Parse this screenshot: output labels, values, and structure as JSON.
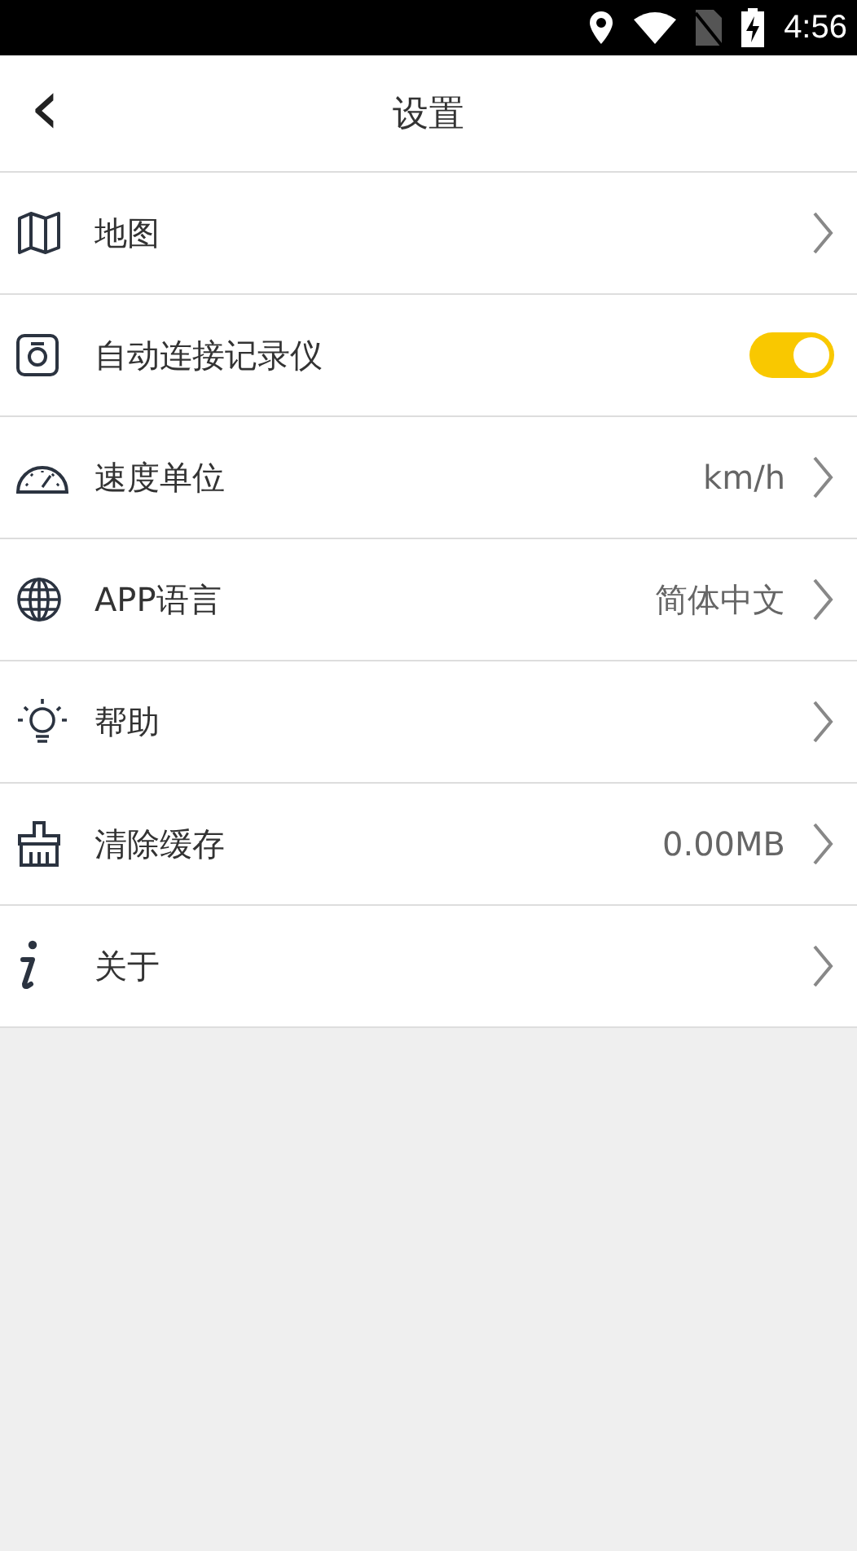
{
  "status_bar": {
    "time": "4:56"
  },
  "header": {
    "back": "‹",
    "title": "设置"
  },
  "rows": [
    {
      "kind": "link",
      "label": "地图"
    },
    {
      "kind": "toggle",
      "label": "自动连接记录仪",
      "on": true
    },
    {
      "kind": "link",
      "label": "速度单位",
      "value": "km/h"
    },
    {
      "kind": "link",
      "label": "APP语言",
      "value": "简体中文"
    },
    {
      "kind": "link",
      "label": "帮助"
    },
    {
      "kind": "link",
      "label": "清除缓存",
      "value": "0.00MB"
    },
    {
      "kind": "link",
      "label": "关于"
    }
  ]
}
